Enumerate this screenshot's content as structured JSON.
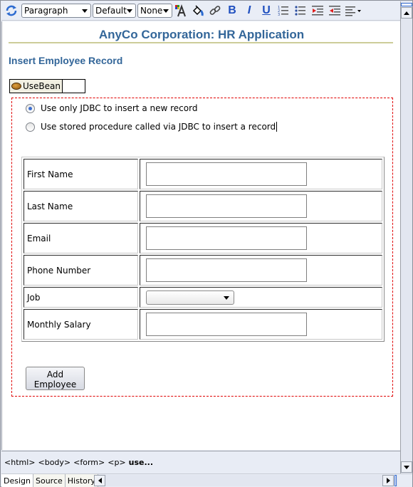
{
  "toolbar": {
    "style_select": "Paragraph",
    "font_select": "Default",
    "size_select": "None",
    "icons": [
      "refresh-icon",
      "text-color-icon",
      "fill-color-icon",
      "link-icon",
      "bold-icon",
      "italic-icon",
      "underline-icon",
      "ordered-list-icon",
      "unordered-list-icon",
      "indent-icon",
      "outdent-icon",
      "align-icon"
    ],
    "bold_label": "B",
    "italic_label": "I",
    "underline_label": "U"
  },
  "page": {
    "app_title": "AnyCo Corporation: HR Application",
    "section_title": "Insert Employee Record",
    "usebean_label": "UseBean",
    "radio_options": [
      {
        "label": "Use only JDBC to insert a new record",
        "checked": true
      },
      {
        "label": "Use stored procedure called via JDBC to insert a record",
        "checked": false
      }
    ],
    "fields": [
      {
        "label": "First Name",
        "type": "text",
        "value": ""
      },
      {
        "label": "Last Name",
        "type": "text",
        "value": ""
      },
      {
        "label": "Email",
        "type": "text",
        "value": ""
      },
      {
        "label": "Phone Number",
        "type": "text",
        "value": ""
      },
      {
        "label": "Job",
        "type": "select",
        "value": ""
      },
      {
        "label": "Monthly Salary",
        "type": "text",
        "value": ""
      }
    ],
    "submit_label": "Add Employee"
  },
  "breadcrumb": [
    "<html>",
    "<body>",
    "<form>",
    "<p>",
    "use..."
  ],
  "tabs": [
    {
      "label": "Design",
      "active": true
    },
    {
      "label": "Source",
      "active": false
    },
    {
      "label": "History",
      "active": false
    }
  ],
  "colors": {
    "heading": "#336699",
    "rule": "#cccc99",
    "form_outline": "#e00000"
  }
}
